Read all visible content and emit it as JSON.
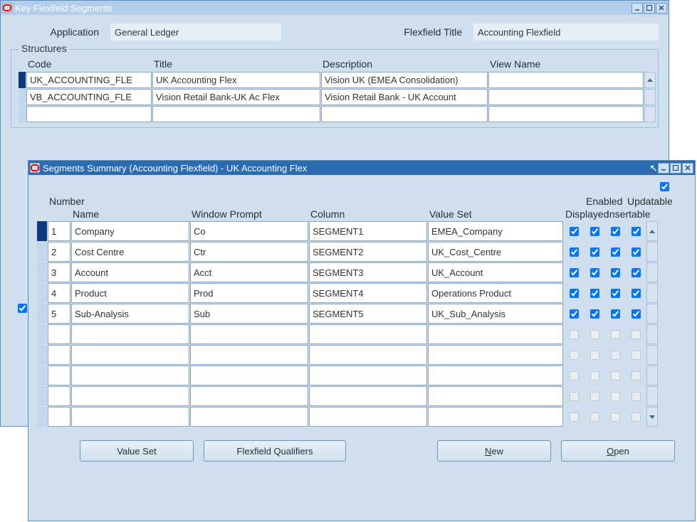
{
  "bg_window": {
    "title": "Key Flexfield Segments",
    "application_label": "Application",
    "application_value": "General Ledger",
    "flexfield_title_label": "Flexfield Title",
    "flexfield_title_value": "Accounting Flexfield",
    "structures_legend": "Structures",
    "headers": {
      "code": "Code",
      "title": "Title",
      "description": "Description",
      "view_name": "View Name"
    },
    "rows": [
      {
        "code": "UK_ACCOUNTING_FLE",
        "title": "UK Accounting Flex",
        "description": "Vision UK (EMEA Consolidation)",
        "view_name": "",
        "selected": true
      },
      {
        "code": "VB_ACCOUNTING_FLE",
        "title": "Vision Retail Bank-UK Ac Flex",
        "description": "Vision Retail Bank - UK Account",
        "view_name": "",
        "selected": false
      },
      {
        "code": "",
        "title": "",
        "description": "",
        "view_name": "",
        "selected": false
      }
    ]
  },
  "fg_window": {
    "title": "Segments Summary (Accounting Flexfield) - UK Accounting Flex",
    "header_row1": {
      "number": "Number",
      "enabled": "Enabled",
      "updatable": "Updatable"
    },
    "header_row2": {
      "name": "Name",
      "window_prompt": "Window Prompt",
      "column": "Column",
      "value_set": "Value Set",
      "displayed": "Displayed",
      "insertable": "Insertable"
    },
    "rows": [
      {
        "num": "1",
        "name": "Company",
        "prompt": "Co",
        "column": "SEGMENT1",
        "value_set": "EMEA_Company",
        "displayed": true,
        "enabled": true,
        "insertable": true,
        "updatable": true,
        "selected": true
      },
      {
        "num": "2",
        "name": "Cost Centre",
        "prompt": "Ctr",
        "column": "SEGMENT2",
        "value_set": "UK_Cost_Centre",
        "displayed": true,
        "enabled": true,
        "insertable": true,
        "updatable": true,
        "selected": false
      },
      {
        "num": "3",
        "name": "Account",
        "prompt": "Acct",
        "column": "SEGMENT3",
        "value_set": "UK_Account",
        "displayed": true,
        "enabled": true,
        "insertable": true,
        "updatable": true,
        "selected": false
      },
      {
        "num": "4",
        "name": "Product",
        "prompt": "Prod",
        "column": "SEGMENT4",
        "value_set": "Operations Product",
        "displayed": true,
        "enabled": true,
        "insertable": true,
        "updatable": true,
        "selected": false
      },
      {
        "num": "5",
        "name": "Sub-Analysis",
        "prompt": "Sub",
        "column": "SEGMENT5",
        "value_set": "UK_Sub_Analysis",
        "displayed": true,
        "enabled": true,
        "insertable": true,
        "updatable": true,
        "selected": false
      },
      {
        "num": "",
        "name": "",
        "prompt": "",
        "column": "",
        "value_set": "",
        "displayed": false,
        "enabled": false,
        "insertable": false,
        "updatable": false,
        "selected": false
      },
      {
        "num": "",
        "name": "",
        "prompt": "",
        "column": "",
        "value_set": "",
        "displayed": false,
        "enabled": false,
        "insertable": false,
        "updatable": false,
        "selected": false
      },
      {
        "num": "",
        "name": "",
        "prompt": "",
        "column": "",
        "value_set": "",
        "displayed": false,
        "enabled": false,
        "insertable": false,
        "updatable": false,
        "selected": false
      },
      {
        "num": "",
        "name": "",
        "prompt": "",
        "column": "",
        "value_set": "",
        "displayed": false,
        "enabled": false,
        "insertable": false,
        "updatable": false,
        "selected": false
      },
      {
        "num": "",
        "name": "",
        "prompt": "",
        "column": "",
        "value_set": "",
        "displayed": false,
        "enabled": false,
        "insertable": false,
        "updatable": false,
        "selected": false
      }
    ],
    "buttons": {
      "value_set": "Value Set",
      "flexfield_qualifiers": "Flexfield Qualifiers",
      "new": "New",
      "open": "Open",
      "new_u": "N",
      "open_u": "O"
    }
  }
}
